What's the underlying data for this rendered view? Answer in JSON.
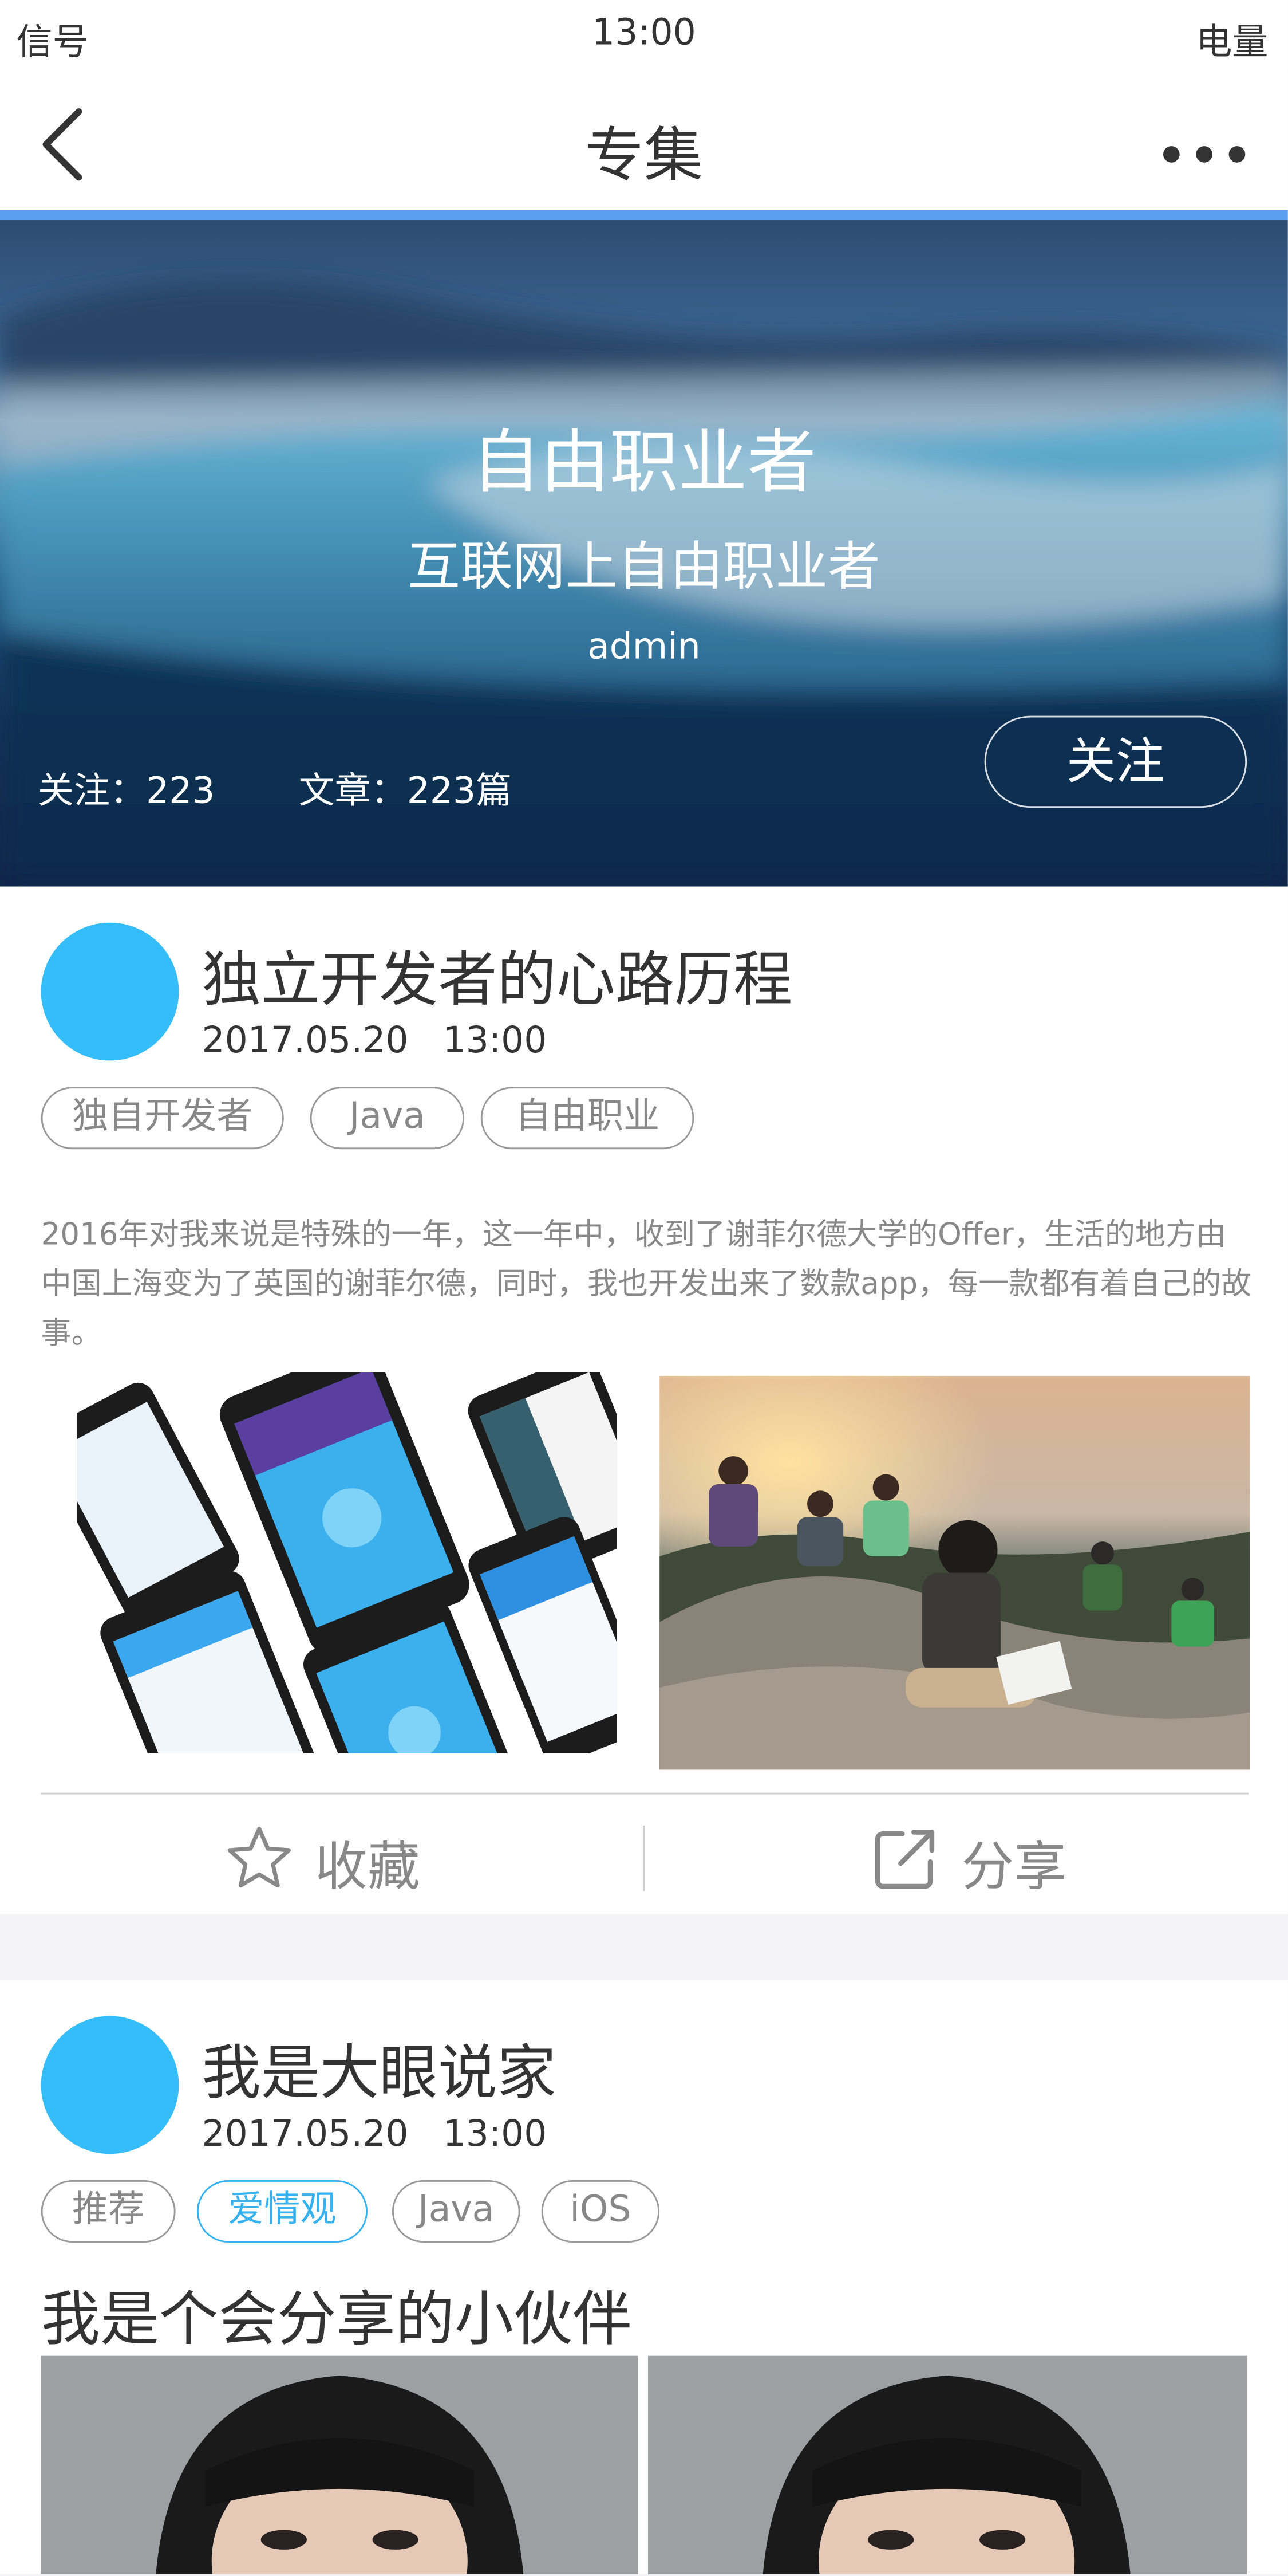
{
  "status_bar": {
    "signal": "信号",
    "time": "13:00",
    "battery": "电量"
  },
  "nav": {
    "title": "专集"
  },
  "header": {
    "title": "自由职业者",
    "subtitle": "互联网上自由职业者",
    "author": "admin",
    "followers": "关注：223",
    "articles": "文章：223篇",
    "follow_button": "关注"
  },
  "posts": [
    {
      "title": "独立开发者的心路历程",
      "date": "2017.05.20   13:00",
      "tags": [
        "独自开发者",
        "Java",
        "自由职业"
      ],
      "excerpt": "2016年对我来说是特殊的一年，这一年中，收到了谢菲尔德大学的Offer，生活的地方由中国上海变为了英国的谢菲尔德，同时，我也开发出来了数款app，每一款都有着自己的故事。",
      "actions": {
        "favorite": "收藏",
        "share": "分享"
      }
    },
    {
      "title": "我是大眼说家",
      "date": "2017.05.20   13:00",
      "tags": [
        "推荐",
        "爱情观",
        "Java",
        "iOS"
      ],
      "heading": "我是个会分享的小伙伴"
    }
  ],
  "colors": {
    "accent": "#5b9ef0",
    "avatar": "#35bdfa",
    "tag_active": "#35b1f0",
    "text": "#333333",
    "muted": "#888888"
  },
  "icons": [
    "back-icon",
    "more-icon",
    "star-icon",
    "share-icon"
  ]
}
